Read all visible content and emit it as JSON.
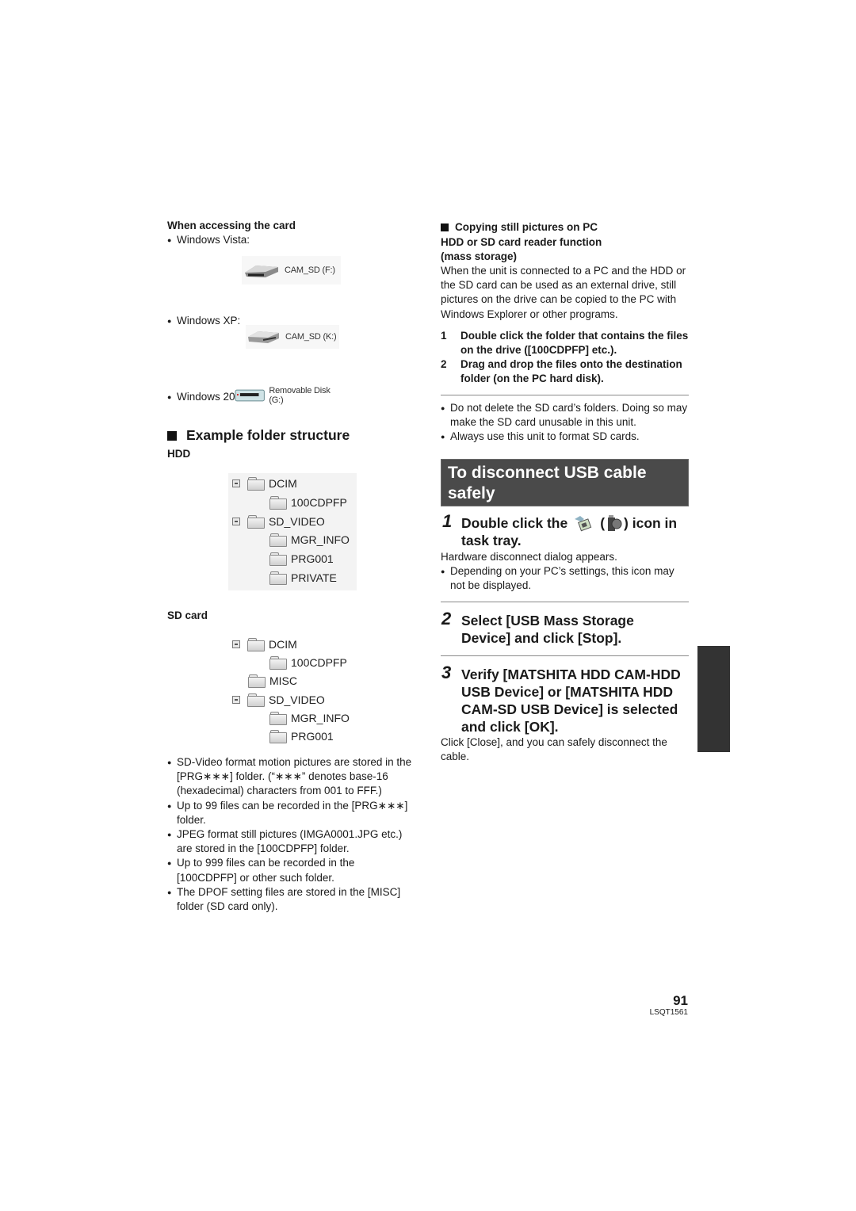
{
  "left": {
    "access_heading": "When accessing the card",
    "os_items": [
      {
        "os": "Windows Vista:",
        "drive_label": "CAM_SD (F:)"
      },
      {
        "os": "Windows XP:",
        "drive_label": "CAM_SD (K:)"
      },
      {
        "os": "Windows 2000:",
        "drive_label": "Removable Disk (G:)"
      }
    ],
    "folder_heading": "Example folder structure",
    "hdd_label": "HDD",
    "hdd_tree": [
      "DCIM",
      "100CDPFP",
      "SD_VIDEO",
      "MGR_INFO",
      "PRG001",
      "PRIVATE"
    ],
    "sd_label": "SD card",
    "sd_tree": [
      "DCIM",
      "100CDPFP",
      "MISC",
      "SD_VIDEO",
      "MGR_INFO",
      "PRG001"
    ],
    "notes": [
      "SD-Video format motion pictures are stored in the [PRG∗∗∗] folder. (“∗∗∗” denotes base-16 (hexadecimal) characters from 001 to FFF.)",
      "Up to 99 files can be recorded in the [PRG∗∗∗] folder.",
      "JPEG format still pictures (IMGA0001.JPG etc.) are stored in the [100CDPFP] folder.",
      "Up to 999 files can be recorded in the [100CDPFP] or other such folder.",
      "The DPOF setting files are stored in the [MISC] folder (SD card only)."
    ]
  },
  "right": {
    "copy_heading_1": "Copying still pictures on PC",
    "copy_heading_2": "HDD or SD card reader function",
    "copy_heading_3": "(mass storage)",
    "copy_body": "When the unit is connected to a PC and the HDD or the SD card can be used as an external drive, still pictures on the drive can be copied to the PC with Windows Explorer or other programs.",
    "copy_steps": [
      {
        "num": "1",
        "text": "Double click the folder that contains the files on the drive ([100CDPFP] etc.)."
      },
      {
        "num": "2",
        "text": "Drag and drop the files onto the destination folder (on the PC hard disk)."
      }
    ],
    "warnings": [
      "Do not delete the SD card’s folders. Doing so may make the SD card unusable in this unit.",
      "Always use this unit to format SD cards."
    ],
    "section_title": "To disconnect USB cable safely",
    "steps": [
      {
        "num": "1",
        "text_a": "Double click the",
        "text_b": "(",
        "text_c": ") icon in",
        "text_d": "task tray.",
        "body": "Hardware disconnect dialog appears.",
        "note": "Depending on your PC’s settings, this icon may not be displayed."
      },
      {
        "num": "2",
        "text": "Select [USB Mass Storage Device] and click [Stop]."
      },
      {
        "num": "3",
        "text": "Verify [MATSHITA HDD CAM-HDD USB Device] or [MATSHITA HDD CAM-SD USB Device] is selected and click [OK].",
        "body": "Click [Close], and you can safely disconnect the cable."
      }
    ]
  },
  "footer": {
    "page_number": "91",
    "doc_code": "LSQT1561"
  },
  "colors": {
    "section_bg": "#4a4a4a",
    "side_tab": "#333333"
  }
}
